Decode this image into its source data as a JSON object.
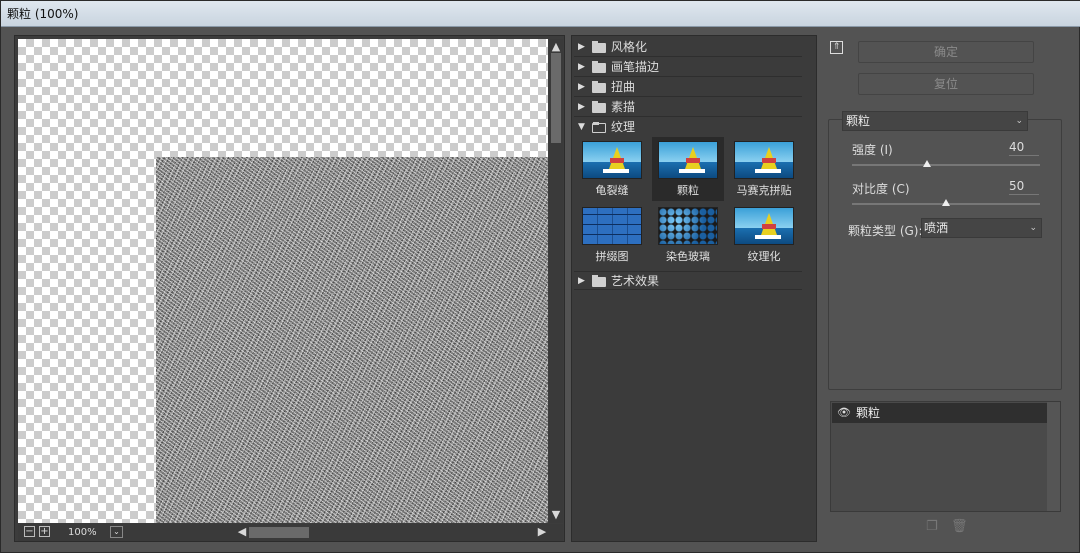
{
  "window": {
    "title": "颗粒 (100%)"
  },
  "preview": {
    "zoom": "100%",
    "zoom_out": "−",
    "zoom_in": "+"
  },
  "gallery": {
    "categories": [
      {
        "label": "风格化",
        "expanded": false
      },
      {
        "label": "画笔描边",
        "expanded": false
      },
      {
        "label": "扭曲",
        "expanded": false
      },
      {
        "label": "素描",
        "expanded": false
      },
      {
        "label": "纹理",
        "expanded": true
      },
      {
        "label": "艺术效果",
        "expanded": false
      }
    ],
    "texture_filters": [
      {
        "label": "龟裂缝",
        "selected": false
      },
      {
        "label": "颗粒",
        "selected": true
      },
      {
        "label": "马赛克拼贴",
        "selected": false
      },
      {
        "label": "拼缀图",
        "selected": false
      },
      {
        "label": "染色玻璃",
        "selected": false
      },
      {
        "label": "纹理化",
        "selected": false
      }
    ]
  },
  "panel": {
    "ok_label": "确定",
    "reset_label": "复位",
    "filter_select": "颗粒",
    "params": [
      {
        "label": "强度 (I)",
        "value": "40",
        "slider_fraction": 0.4
      },
      {
        "label": "对比度 (C)",
        "value": "50",
        "slider_fraction": 0.5
      }
    ],
    "grain_type_label": "颗粒类型 (G):",
    "grain_type_value": "喷洒"
  },
  "layers": [
    {
      "name": "颗粒",
      "visible": true
    }
  ],
  "icons": [
    "expand-collapse-icon",
    "eye-icon",
    "new-layer-icon",
    "trash-icon",
    "folder-icon",
    "triangle-right-icon",
    "chevron-down-icon"
  ]
}
